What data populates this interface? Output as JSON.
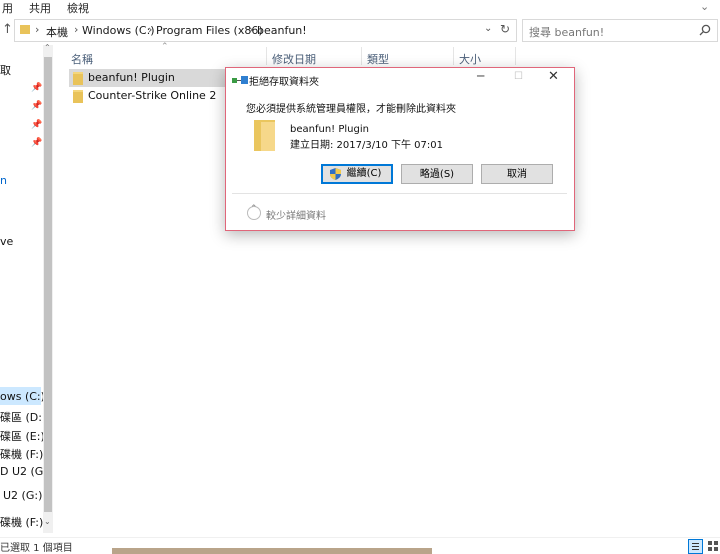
{
  "ribbon": {
    "tabs": [
      "用",
      "共用",
      "檢視"
    ]
  },
  "address": {
    "crumbs": [
      "本機",
      "Windows (C:)",
      "Program Files (x86)",
      "beanfun!"
    ],
    "search_placeholder": "搜尋 beanfun!"
  },
  "columns": [
    "名稱",
    "修改日期",
    "類型",
    "大小"
  ],
  "files": [
    {
      "name": "beanfun! Plugin",
      "selected": true
    },
    {
      "name": "Counter-Strike Online 2",
      "selected": false
    }
  ],
  "sidebar": {
    "items": [
      "取",
      "n",
      "ve",
      "ows (C:)",
      "碟區 (D:)",
      "碟區 (E:)",
      "碟機 (F:)",
      "D U2 (G:)",
      "U2 (G:)",
      "碟機 (F:)"
    ]
  },
  "status": {
    "text": "已選取 1 個項目"
  },
  "dialog": {
    "title": "拒絕存取資料夾",
    "message": "您必須提供系統管理員權限，才能刪除此資料夾",
    "item_name": "beanfun! Plugin",
    "item_created": "建立日期: 2017/3/10 下午 07:01",
    "continue_label": "繼續(C)",
    "skip_label": "略過(S)",
    "cancel_label": "取消",
    "details_label": "較少詳細資料"
  },
  "colors": {
    "dialog_border": "#e0667a",
    "accent": "#0078d7",
    "selected_row": "#cce8ff"
  }
}
